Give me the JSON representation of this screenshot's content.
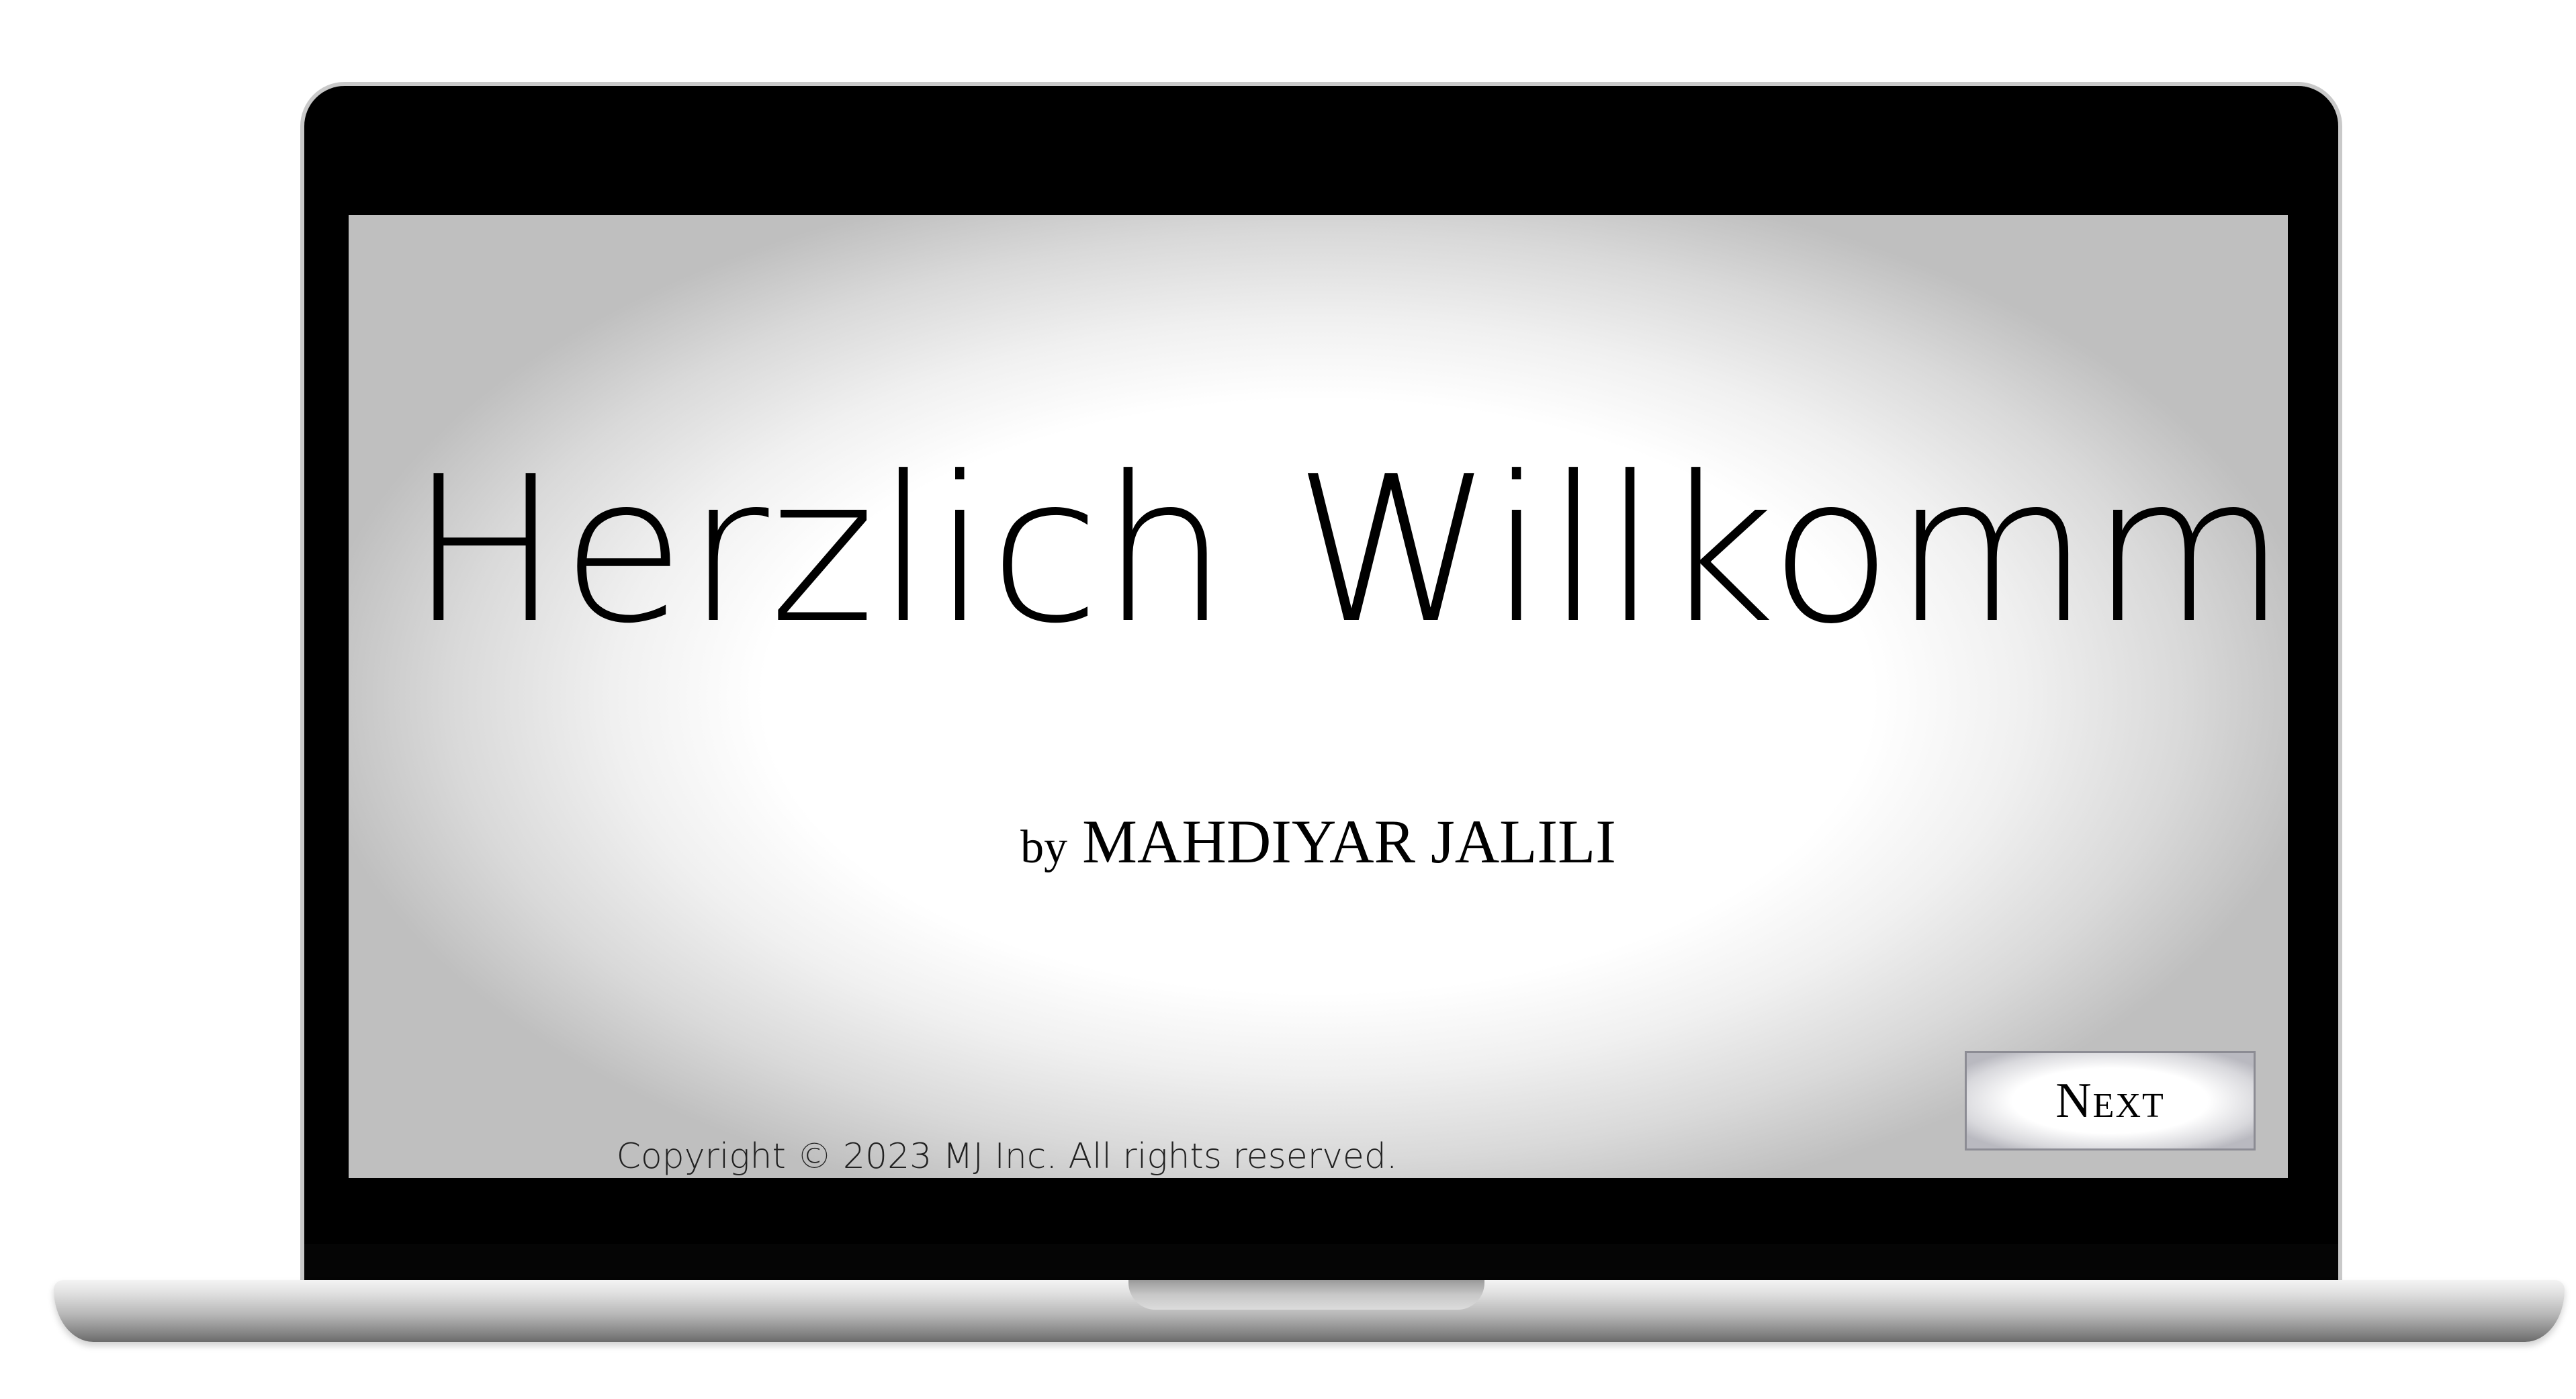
{
  "screen": {
    "title": "Herzlich Willkommen",
    "byline_prefix": "by",
    "byline_name": "MAHDIYAR JALILI",
    "copyright": "Copyright © 2023 MJ Inc. All rights reserved.",
    "next_button_label": "Next"
  },
  "colors": {
    "screen_center": "#ffffff",
    "screen_edge": "#bfbfbf",
    "bezel": "#000000",
    "text": "#000000"
  },
  "icons": {
    "device": "laptop-icon"
  }
}
